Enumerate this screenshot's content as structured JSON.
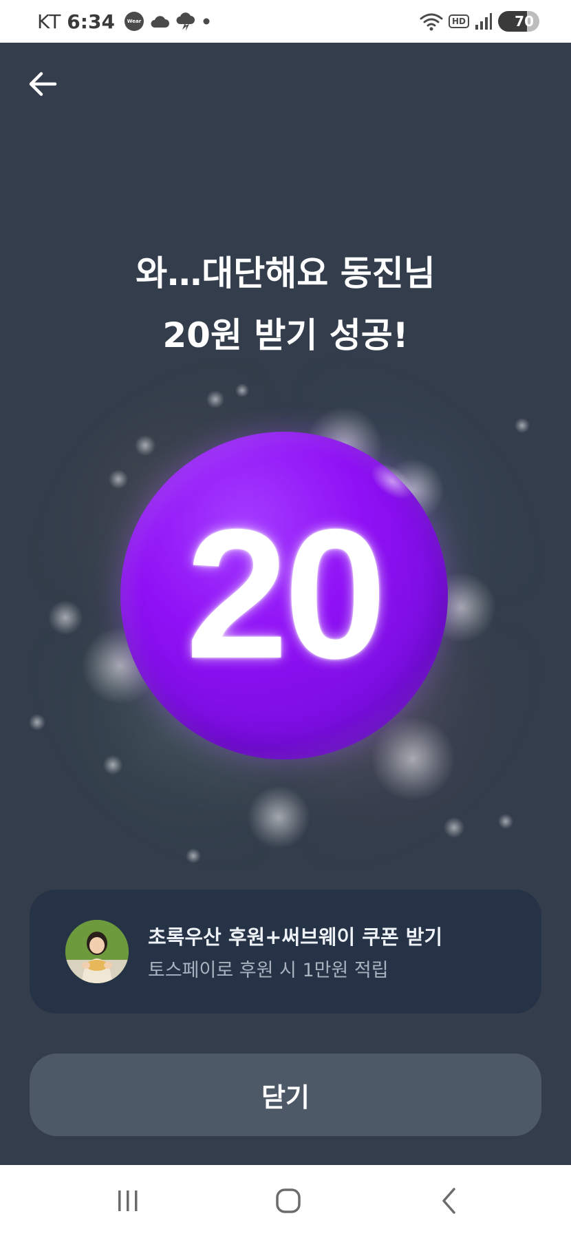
{
  "status_bar": {
    "carrier": "KT",
    "time": "6:34",
    "wear_badge": "Wear",
    "hd_label": "HD",
    "battery": "70",
    "icons": [
      "wear-icon",
      "cloud-icon",
      "cloud-lightning-icon",
      "dot-icon",
      "wifi-icon",
      "signal-icon",
      "battery-icon"
    ]
  },
  "header": {
    "back_icon": "arrow-left-icon"
  },
  "result": {
    "headline_line1": "와…대단해요 동진님",
    "headline_line2": "20원 받기 성공!",
    "amount": "20",
    "ball_color": "#8f10f5"
  },
  "promo": {
    "title": "초록우산 후원+써브웨이 쿠폰 받기",
    "subtitle": "토스페이로 후원 시 1만원 적립",
    "avatar_icon": "child-photo"
  },
  "actions": {
    "close_label": "닫기"
  },
  "nav_bar": {
    "items": [
      "recent-apps-icon",
      "home-icon",
      "back-icon"
    ]
  },
  "colors": {
    "background": "#333d4b",
    "card": "#263346",
    "button": "#4e5968",
    "accent": "#8f10f5"
  }
}
